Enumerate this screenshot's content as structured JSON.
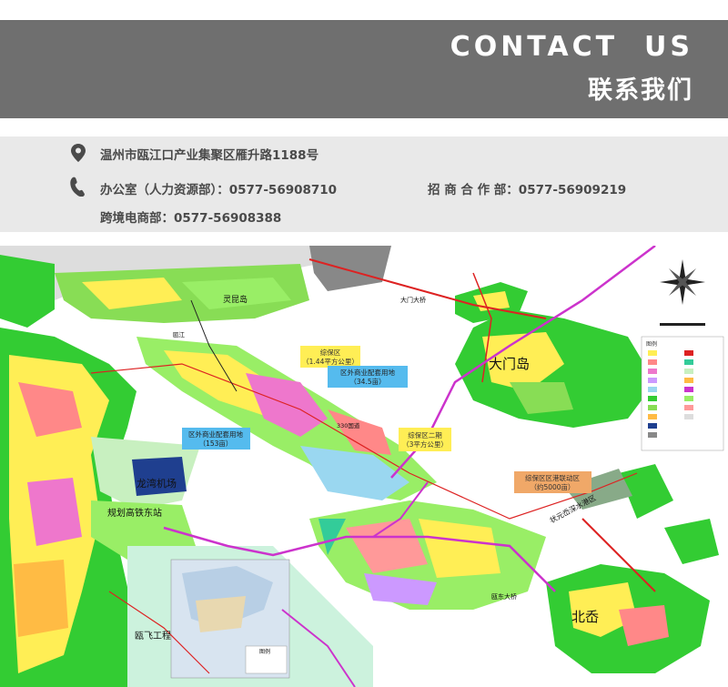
{
  "header": {
    "title": "CONTACT  US",
    "subtitle": "联系我们"
  },
  "contact": {
    "address": "温州市瓯江口产业集聚区雁升路1188号",
    "office": "办公室（人力资源部）：0577-56908710",
    "investment": "招 商 合 作 部：0577-56909219",
    "ecommerce": "跨境电商部：0577-56908388",
    "icons": [
      "location-pin-icon",
      "phone-icon"
    ]
  },
  "map": {
    "labels": {
      "lingkun": "灵昆岛",
      "damen_island": "大门岛",
      "beiqi": "北岙",
      "airport": "龙湾机场",
      "hsr_station": "规划高铁东站",
      "oufei": "瓯飞工程",
      "bridge_damen": "大门大桥",
      "bridge_oudong": "瓯东大桥",
      "tie_shui": "状元岙深水港区",
      "road_330": "330国道",
      "road_oujiang": "瓯江",
      "zone_1": "综保区",
      "zone_1_area": "（1.44平方公里）",
      "zone_outer_1": "区外商业配套用地",
      "zone_outer_1_area": "（34.5亩）",
      "zone_outer_2": "区外商业配套用地",
      "zone_outer_2_area": "（153亩）",
      "zone_2": "综保区二期",
      "zone_2_area": "（3平方公里）",
      "zone_port": "综保区区港联动区",
      "zone_port_area": "（约5000亩）",
      "legend_title": "图例",
      "inset_legend": "图例"
    },
    "colors": {
      "header_bg": "#6f6f6f",
      "contact_bg": "#e9e9e9",
      "green": "#33cc33",
      "yellow": "#ffee55",
      "water": "#ffffff",
      "road_magenta": "#cc33cc",
      "road_red": "#dd2222"
    }
  }
}
